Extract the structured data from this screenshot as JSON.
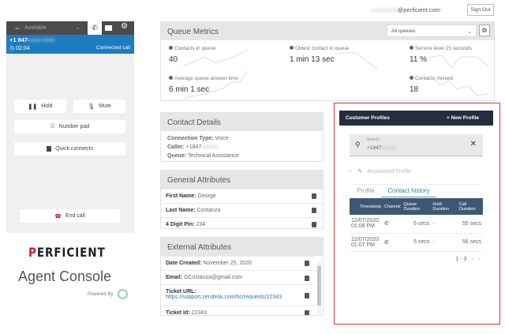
{
  "header": {
    "user_email": "@perficient.com",
    "sign_out": "Sign Out"
  },
  "ccp": {
    "status": "Available",
    "phone": "+1 847-",
    "timer": "02:04",
    "call_state": "Connected call",
    "hold": "Hold",
    "mute": "Mute",
    "number_pad": "Number pad",
    "quick_connects": "Quick connects",
    "end_call": "End call"
  },
  "brand": {
    "logo": "PERFICIENT",
    "app_name": "Agent Console",
    "powered_by": "Powered By"
  },
  "queue_metrics": {
    "title": "Queue Metrics",
    "queue_select": "All queues",
    "metrics": [
      {
        "label": "Contacts in queue",
        "value": "40"
      },
      {
        "label": "Oldest contact in queue",
        "value": "1 min 13 sec"
      },
      {
        "label": "Service level 15 seconds",
        "value": "11 %"
      },
      {
        "label": "Average queue answer time",
        "value": "6 min 1 sec"
      },
      {
        "label": "Contacts missed",
        "value": "18"
      }
    ]
  },
  "contact_details": {
    "title": "Contact Details",
    "rows": [
      {
        "label": "Connection Type:",
        "value": "Voice"
      },
      {
        "label": "Caller:",
        "value": "+1847"
      },
      {
        "label": "Queue:",
        "value": "Technical Assistance"
      }
    ]
  },
  "general_attributes": {
    "title": "General Attributes",
    "rows": [
      {
        "label": "First Name:",
        "value": "George"
      },
      {
        "label": "Last Name:",
        "value": "Costanza"
      },
      {
        "label": "4 Digit Pin:",
        "value": "234"
      }
    ]
  },
  "external_attributes": {
    "title": "External Attributes",
    "rows": [
      {
        "label": "Date Created:",
        "value": "November 25, 2020"
      },
      {
        "label": "Email:",
        "value": "GCostanza@gmail.com"
      },
      {
        "label": "Ticket URL:",
        "value": "https://support.zendesk.com/hc/requests/22343"
      },
      {
        "label": "Ticket Id:",
        "value": "22343"
      }
    ]
  },
  "customer_profiles": {
    "title": "Customer Profiles",
    "new_profile": "+ New Profile",
    "search_label": "Search",
    "search_value": "+1847",
    "associated_profile_prefix": "-",
    "associated_profile": "Associated Profile",
    "tabs": [
      "Profile",
      "Contact history"
    ],
    "active_tab": "Contact history",
    "columns": [
      "Timestamp",
      "Channel",
      "Queue Duration",
      "Hold Duration",
      "Call Duration"
    ],
    "rows": [
      {
        "date": "12/07/2020",
        "time": "01:08 PM",
        "queue": "6 secs",
        "hold": "-",
        "call": "55 secs"
      },
      {
        "date": "12/07/2020",
        "time": "01:07 PM",
        "queue": "5 secs",
        "hold": "-",
        "call": "56 secs"
      }
    ],
    "pagination": "1 - 3"
  },
  "colors": {
    "ccp_blue": "#1d7cbf",
    "table_header": "#3e5873",
    "highlight_border": "#c8373c",
    "brand_red": "#c8202d"
  }
}
